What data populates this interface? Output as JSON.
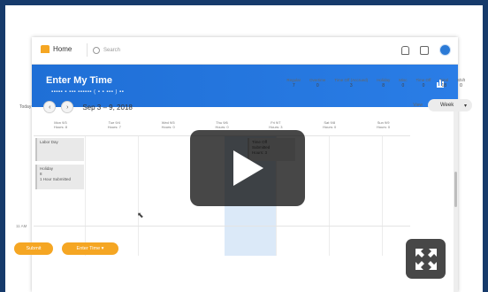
{
  "app": {
    "home_label": "Home",
    "search_placeholder": "Search"
  },
  "banner": {
    "title": "Enter My Time",
    "subtitle": "▪▪▪▪▪ ▪ ▪▪▪  ▪▪▪▪▪▪ ( ▪ ▪ ▪▪▪ ) ▪▪"
  },
  "totals": [
    {
      "label": "Regular",
      "value": "7"
    },
    {
      "label": "Overtime",
      "value": "0"
    },
    {
      "label": "Time Off (Accrued)",
      "value": "3"
    },
    {
      "label": "Holiday",
      "value": "8"
    },
    {
      "label": "Misc",
      "value": "0"
    },
    {
      "label": "Time Off",
      "value": "0"
    },
    {
      "label": "Total",
      "value": "18"
    },
    {
      "label": "Shift",
      "value": "0"
    }
  ],
  "toolbar": {
    "today_label": "Today",
    "prev_glyph": "‹",
    "next_glyph": "›",
    "date_range": "Sep 3 – 9, 2018",
    "view_label": "View",
    "view_value": "Week",
    "view_chevron": "▾"
  },
  "days": [
    {
      "name": "Mon 9/3",
      "hours": "Hours: 8"
    },
    {
      "name": "Tue 9/4",
      "hours": "Hours: 7"
    },
    {
      "name": "Wed 9/5",
      "hours": "Hours: 0"
    },
    {
      "name": "Thu 9/6",
      "hours": "Hours: 0"
    },
    {
      "name": "Fri 9/7",
      "hours": "Hours: 3"
    },
    {
      "name": "Sat 9/8",
      "hours": "Hours: 0"
    },
    {
      "name": "Sun 9/9",
      "hours": "Hours: 0"
    }
  ],
  "events": {
    "labor_day": "Labor Day",
    "holiday": "Holiday\n8\n1 Hour Submitted",
    "thursday": "Time Off\nSubmitted\nHours: 3"
  },
  "time_marker": "11 AM",
  "actions": {
    "submit_label": "Submit",
    "enter_time_label": "Enter Time ▾"
  },
  "overlay": {
    "play_icon": "play-icon",
    "expand_icon": "expand-icon"
  },
  "colors": {
    "frame": "#163a6b",
    "banner": "#1f6fd6",
    "accent": "#f5a623",
    "highlight_col": "#dbe9f8"
  }
}
